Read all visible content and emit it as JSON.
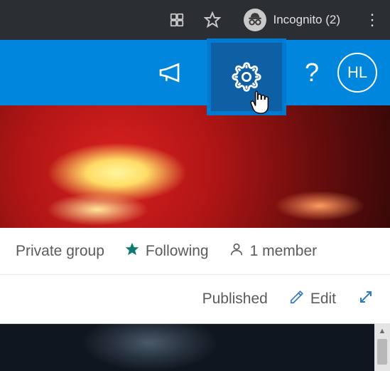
{
  "browser": {
    "incognito_label": "Incognito (2)"
  },
  "header": {
    "avatar_initials": "HL",
    "help_label": "?"
  },
  "info": {
    "privacy": "Private group",
    "following": "Following",
    "members": "1 member"
  },
  "actions": {
    "published": "Published",
    "edit": "Edit"
  }
}
